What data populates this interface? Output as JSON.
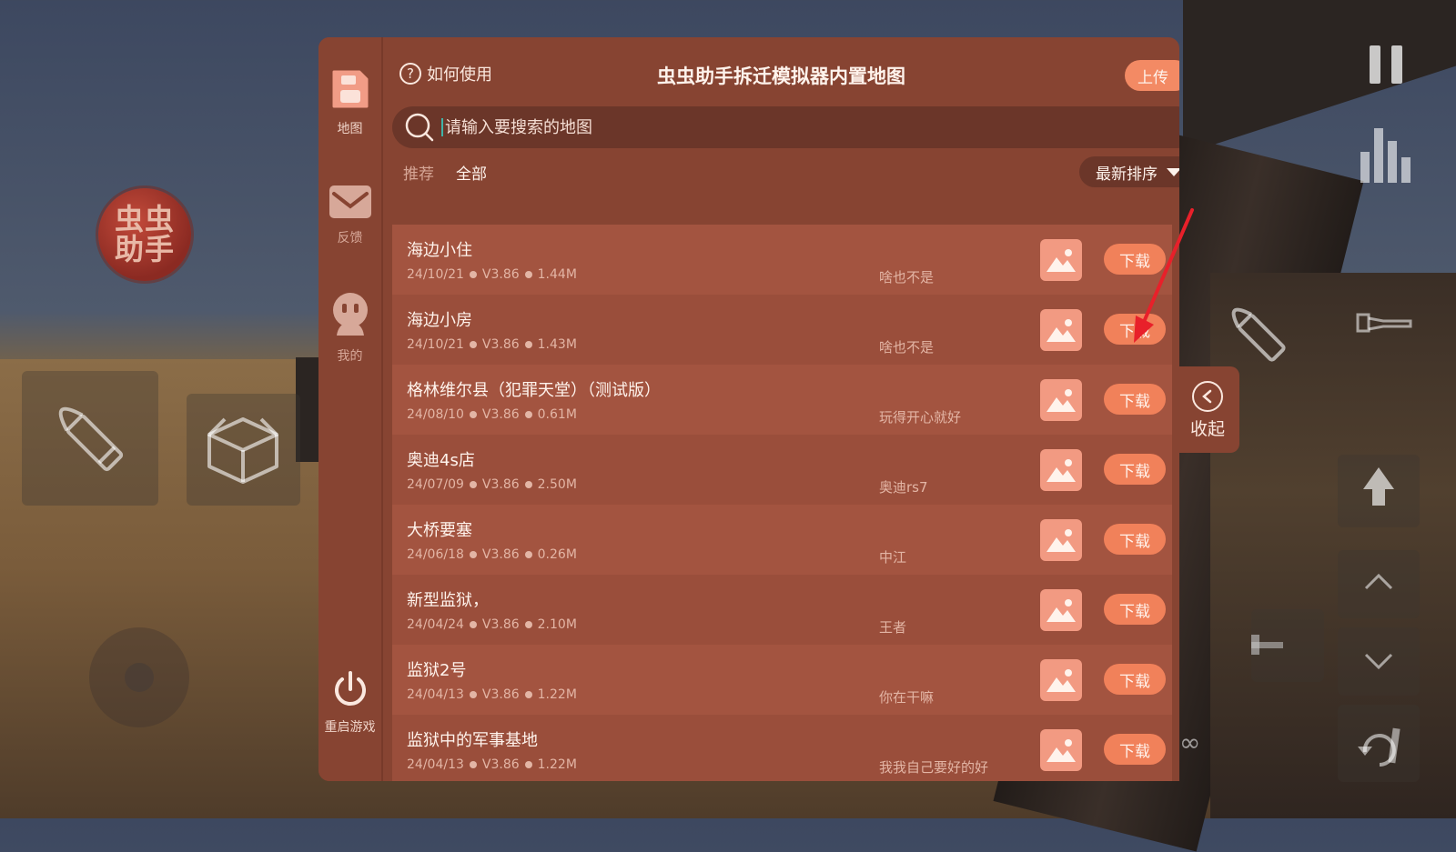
{
  "app": {
    "title": "虫虫助手拆迁模拟器内置地图",
    "logo_text": "虫虫助手",
    "help_label": "如何使用",
    "upload_label": "上传"
  },
  "sidebar": {
    "items": [
      {
        "label": "地图",
        "icon": "save-disk-icon",
        "active": true
      },
      {
        "label": "反馈",
        "icon": "envelope-icon",
        "active": false
      },
      {
        "label": "我的",
        "icon": "face-icon",
        "active": false
      },
      {
        "label": "重启游戏",
        "icon": "power-icon",
        "active": false
      }
    ]
  },
  "search": {
    "placeholder": "请输入要搜索的地图",
    "value": ""
  },
  "tabs": [
    {
      "label": "推荐",
      "active": false
    },
    {
      "label": "全部",
      "active": true
    }
  ],
  "sort": {
    "label": "最新排序"
  },
  "maps": [
    {
      "name": "海边小住",
      "date": "24/10/21",
      "version": "V3.86",
      "size": "1.44M",
      "author": "啥也不是",
      "action": "下载"
    },
    {
      "name": "海边小房",
      "date": "24/10/21",
      "version": "V3.86",
      "size": "1.43M",
      "author": "啥也不是",
      "action": "下载"
    },
    {
      "name": "格林维尔县（犯罪天堂）（测试版）",
      "date": "24/08/10",
      "version": "V3.86",
      "size": "0.61M",
      "author": "玩得开心就好",
      "action": "下载"
    },
    {
      "name": "奥迪4s店",
      "date": "24/07/09",
      "version": "V3.86",
      "size": "2.50M",
      "author": "奥迪rs7",
      "action": "下载"
    },
    {
      "name": "大桥要塞",
      "date": "24/06/18",
      "version": "V3.86",
      "size": "0.26M",
      "author": "中江",
      "action": "下载"
    },
    {
      "name": "新型监狱，",
      "date": "24/04/24",
      "version": "V3.86",
      "size": "2.10M",
      "author": "王者",
      "action": "下载"
    },
    {
      "name": "监狱2号",
      "date": "24/04/13",
      "version": "V3.86",
      "size": "1.22M",
      "author": "你在干嘛",
      "action": "下载"
    },
    {
      "name": "监狱中的军事基地",
      "date": "24/04/13",
      "version": "V3.86",
      "size": "1.22M",
      "author": "我我自己要好的好",
      "action": "下载"
    }
  ],
  "collapse": {
    "label": "收起"
  },
  "hud": {
    "infinity": "∞"
  },
  "colors": {
    "panel": "#874432",
    "row": "#a35440",
    "accent": "#f1815a",
    "annotation_arrow": "#e8202a"
  }
}
